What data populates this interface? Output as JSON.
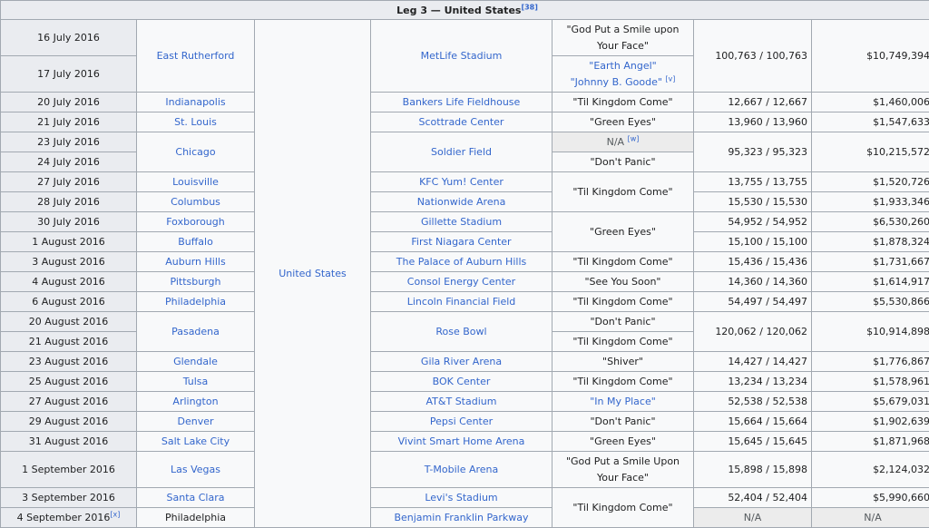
{
  "leg_title": "Leg 3 — United States",
  "leg_ref": "[38]",
  "country": "United States",
  "dates": [
    "16 July 2016",
    "17 July 2016",
    "20 July 2016",
    "21 July 2016",
    "23 July 2016",
    "24 July 2016",
    "27 July 2016",
    "28 July 2016",
    "30 July 2016",
    "1 August 2016",
    "3 August 2016",
    "4 August 2016",
    "6 August 2016",
    "20 August 2016",
    "21 August 2016",
    "23 August 2016",
    "25 August 2016",
    "27 August 2016",
    "29 August 2016",
    "31 August 2016",
    "1 September 2016",
    "3 September 2016",
    "4 September 2016"
  ],
  "date_note_last": "[x]",
  "cities": [
    "East Rutherford",
    "Indianapolis",
    "St. Louis",
    "Chicago",
    "Louisville",
    "Columbus",
    "Foxborough",
    "Buffalo",
    "Auburn Hills",
    "Pittsburgh",
    "Philadelphia",
    "Pasadena",
    "Glendale",
    "Tulsa",
    "Arlington",
    "Denver",
    "Salt Lake City",
    "Las Vegas",
    "Santa Clara",
    "Philadelphia"
  ],
  "venues": [
    "MetLife Stadium",
    "Bankers Life Fieldhouse",
    "Scottrade Center",
    "Soldier Field",
    "KFC Yum! Center",
    "Nationwide Arena",
    "Gillette Stadium",
    "First Niagara Center",
    "The Palace of Auburn Hills",
    "Consol Energy Center",
    "Lincoln Financial Field",
    "Rose Bowl",
    "Gila River Arena",
    "BOK Center",
    "AT&T Stadium",
    "Pepsi Center",
    "Vivint Smart Home Arena",
    "T-Mobile Arena",
    "Levi's Stadium",
    "Benjamin Franklin Parkway"
  ],
  "songs": {
    "s1a": "\"God Put a Smile upon",
    "s1b": "Your Face\"",
    "s2a": "\"Earth Angel\"",
    "s2b": "\"Johnny B. Goode\"",
    "s2_note": "[v]",
    "s3": "\"Til Kingdom Come\"",
    "s4": "\"Green Eyes\"",
    "s5": "N/A",
    "s5_note": "[w]",
    "s6": "\"Don't Panic\"",
    "s7": "\"Til Kingdom Come\"",
    "s8": "\"Green Eyes\"",
    "s9": "\"Til Kingdom Come\"",
    "s10": "\"See You Soon\"",
    "s11": "\"Til Kingdom Come\"",
    "s12": "\"Don't Panic\"",
    "s13": "\"Til Kingdom Come\"",
    "s14": "\"Shiver\"",
    "s15": "\"Til Kingdom Come\"",
    "s16": "\"In My Place\"",
    "s17": "\"Don't Panic\"",
    "s18": "\"Green Eyes\"",
    "s19a": "\"God Put a Smile Upon",
    "s19b": "Your Face\"",
    "s20": "\"Til Kingdom Come\""
  },
  "attendance": [
    "100,763 / 100,763",
    "12,667 / 12,667",
    "13,960 / 13,960",
    "95,323 / 95,323",
    "13,755 / 13,755",
    "15,530 / 15,530",
    "54,952 / 54,952",
    "15,100 / 15,100",
    "15,436 / 15,436",
    "14,360 / 14,360",
    "54,497 / 54,497",
    "120,062 / 120,062",
    "14,427 / 14,427",
    "13,234 / 13,234",
    "52,538 / 52,538",
    "15,664 / 15,664",
    "15,645 / 15,645",
    "15,898 / 15,898",
    "52,404 / 52,404",
    "N/A"
  ],
  "gross": [
    "$10,749,394",
    "$1,460,006",
    "$1,547,633",
    "$10,215,572",
    "$1,520,726",
    "$1,933,346",
    "$6,530,260",
    "$1,878,324",
    "$1,731,667",
    "$1,614,917",
    "$5,530,866",
    "$10,914,898",
    "$1,776,867",
    "$1,578,961",
    "$5,679,031",
    "$1,902,639",
    "$1,871,968",
    "$2,124,032",
    "$5,990,660",
    "N/A"
  ]
}
